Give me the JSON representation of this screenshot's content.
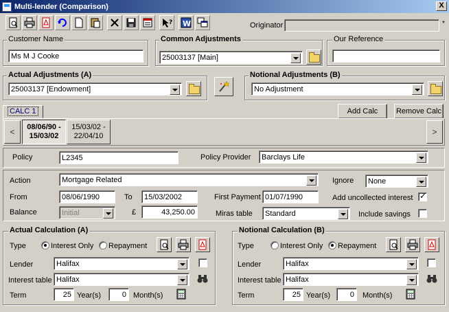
{
  "window": {
    "title": "Multi-lender (Comparison)",
    "close": "X"
  },
  "toolbar": {
    "buttons": [
      "new-doc-icon",
      "print-icon",
      "pdf-icon",
      "undo-icon",
      "blank-doc-icon",
      "paste-icon",
      "delete-icon",
      "save-icon",
      "calculator-icon",
      "help-icon",
      "word-icon",
      "windows-icon"
    ]
  },
  "originator": {
    "label": "Originator",
    "value": "",
    "required_mark": "*"
  },
  "customer": {
    "label": "Customer Name",
    "value": "Ms M J Cooke"
  },
  "common": {
    "label": "Common Adjustments",
    "value": "25003137 [Main]"
  },
  "reference": {
    "label": "Our Reference",
    "value": ""
  },
  "actual_adj": {
    "label": "Actual Adjustments (A)",
    "value": "25003137 [Endowment]"
  },
  "notional_adj": {
    "label": "Notional Adjustments (B)",
    "value": "No Adjustment"
  },
  "calc_tab": {
    "label": "CALC 1"
  },
  "buttons": {
    "add_calc": "Add Calc",
    "remove_calc": "Remove Calc"
  },
  "periods": [
    {
      "line1": "08/06/90 -",
      "line2": "15/03/02",
      "active": true
    },
    {
      "line1": "15/03/02 -",
      "line2": "22/04/10",
      "active": false
    }
  ],
  "nav": {
    "prev": "<",
    "next": ">"
  },
  "policy": {
    "label": "Policy",
    "value": "L2345",
    "provider_label": "Policy Provider",
    "provider": "Barclays Life"
  },
  "details": {
    "action_label": "Action",
    "action": "Mortgage Related",
    "ignore_label": "Ignore",
    "ignore": "None",
    "from_label": "From",
    "from": "08/06/1990",
    "to_label": "To",
    "to": "15/03/2002",
    "first_payment_label": "First Payment",
    "first_payment": "01/07/1990",
    "add_uncollected_label": "Add uncollected interest",
    "balance_label": "Balance",
    "balance_type": "Initial",
    "currency": "£",
    "balance": "43,250.00",
    "miras_label": "Miras table",
    "miras": "Standard",
    "include_savings_label": "Include savings"
  },
  "actual_calc": {
    "label": "Actual Calculation (A)",
    "type_label": "Type",
    "opt1": "Interest Only",
    "opt2": "Repayment",
    "lender_label": "Lender",
    "lender": "Halifax",
    "interest_label": "Interest table",
    "interest": "Halifax",
    "term_label": "Term",
    "years": "25",
    "years_label": "Year(s)",
    "months": "0",
    "months_label": "Month(s)"
  },
  "notional_calc": {
    "label": "Notional Calculation (B)",
    "type_label": "Type",
    "opt1": "Interest Only",
    "opt2": "Repayment",
    "lender_label": "Lender",
    "lender": "Halifax",
    "interest_label": "Interest table",
    "interest": "Halifax",
    "term_label": "Term",
    "years": "25",
    "years_label": "Year(s)",
    "months": "0",
    "months_label": "Month(s)"
  }
}
